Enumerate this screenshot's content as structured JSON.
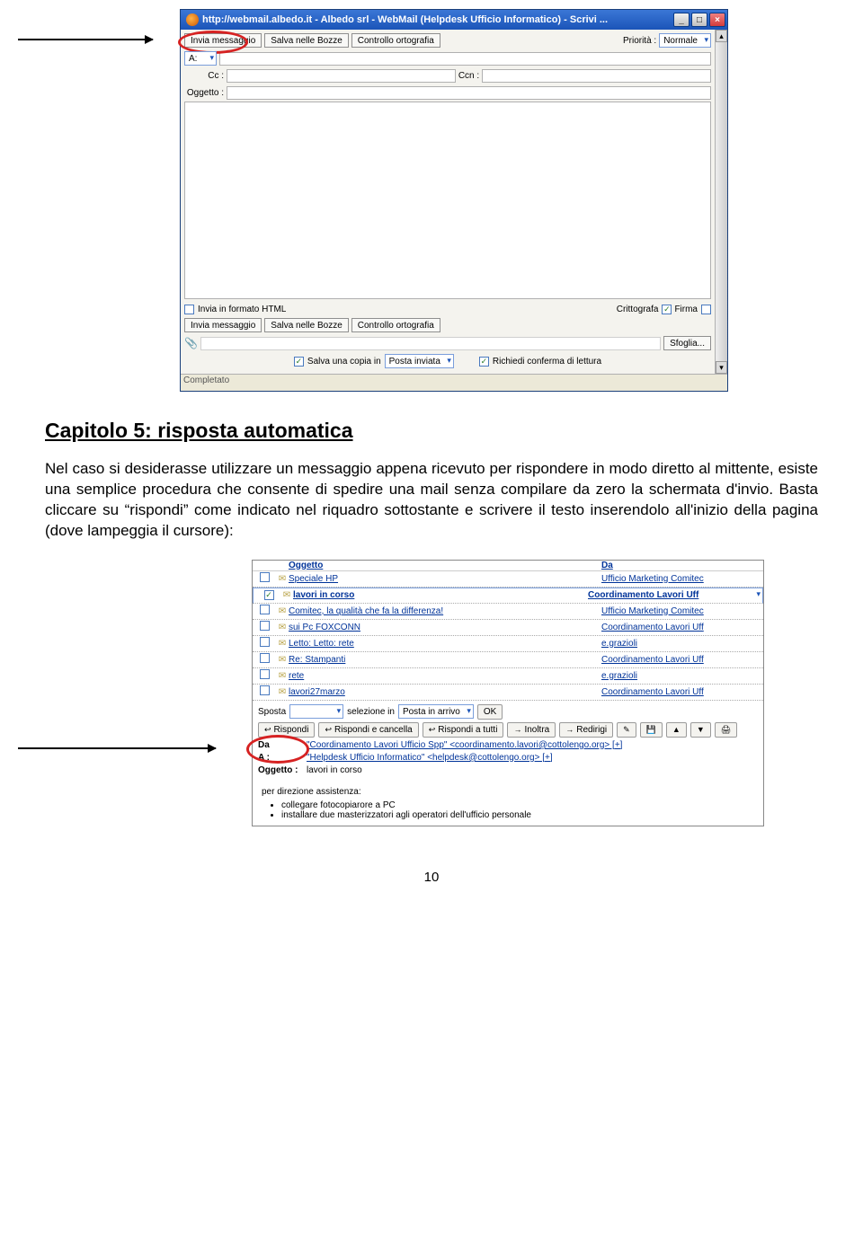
{
  "compose": {
    "title": "http://webmail.albedo.it - Albedo srl - WebMail (Helpdesk Ufficio Informatico) - Scrivi ...",
    "btn_send": "Invia messaggio",
    "btn_draft": "Salva nelle Bozze",
    "btn_spell": "Controllo ortografia",
    "priority_label": "Priorità :",
    "priority_val": "Normale",
    "field_a": "A:",
    "field_cc": "Cc :",
    "field_ccn": "Ccn :",
    "field_subject": "Oggetto :",
    "chk_html": "Invia in formato HTML",
    "chk_crypt": "Crittografa",
    "chk_sign": "Firma",
    "btn_browse": "Sfoglia...",
    "chk_save_copy": "Salva una copia in",
    "save_copy_folder": "Posta inviata",
    "chk_receipt": "Richiedi conferma di lettura",
    "status": "Completato"
  },
  "doc": {
    "title": "Capitolo 5: risposta automatica",
    "para": "Nel caso si desiderasse utilizzare un messaggio appena ricevuto per rispondere in modo diretto al mittente, esiste una semplice procedura che consente di spedire una mail senza compilare da zero la schermata d'invio. Basta cliccare su “rispondi” come indicato nel riquadro sottostante e scrivere il testo inserendolo all'inizio della pagina (dove lampeggia il cursore):",
    "page_num": "10"
  },
  "inbox": {
    "header_subject": "Oggetto",
    "header_from": "Da",
    "rows": [
      {
        "checked": false,
        "subject": "Speciale HP",
        "from": "Ufficio Marketing Comitec",
        "bold": false
      },
      {
        "checked": true,
        "subject": "lavori in corso",
        "from": "Coordinamento Lavori Uff",
        "bold": true
      },
      {
        "checked": false,
        "subject": "Comitec, la qualità che fa la differenza!",
        "from": "Ufficio Marketing Comitec",
        "bold": false
      },
      {
        "checked": false,
        "subject": "sui Pc FOXCONN",
        "from": "Coordinamento Lavori Uff",
        "bold": false
      },
      {
        "checked": false,
        "subject": "Letto: Letto: rete",
        "from": "e.grazioli",
        "bold": false
      },
      {
        "checked": false,
        "subject": "Re: Stampanti",
        "from": "Coordinamento Lavori Uff",
        "bold": false
      },
      {
        "checked": false,
        "subject": "rete",
        "from": "e.grazioli",
        "bold": false
      },
      {
        "checked": false,
        "subject": "lavori27marzo",
        "from": "Coordinamento Lavori Uff",
        "bold": false
      }
    ],
    "move_label": "Sposta",
    "move_sel_label": "selezione in",
    "move_folder": "Posta in arrivo",
    "move_ok": "OK",
    "btn_reply": "Rispondi",
    "btn_reply_del": "Rispondi e cancella",
    "btn_reply_all": "Rispondi a tutti",
    "btn_forward": "Inoltra",
    "btn_redirect": "Redirigi",
    "lbl_da": "Da",
    "val_da": "\"Coordinamento Lavori Ufficio Spp\" <coordinamento.lavori@cottolengo.org> [+]",
    "lbl_a": "A :",
    "val_a": "\"Helpdesk Ufficio Informatico\" <helpdesk@cottolengo.org> [+]",
    "lbl_oggetto": "Oggetto :",
    "val_oggetto": "lavori in corso",
    "preview_line": "per direzione assistenza:",
    "preview_b1": "collegare fotocopiarore a PC",
    "preview_b2": "installare due masterizzatori agli operatori dell'ufficio personale"
  }
}
